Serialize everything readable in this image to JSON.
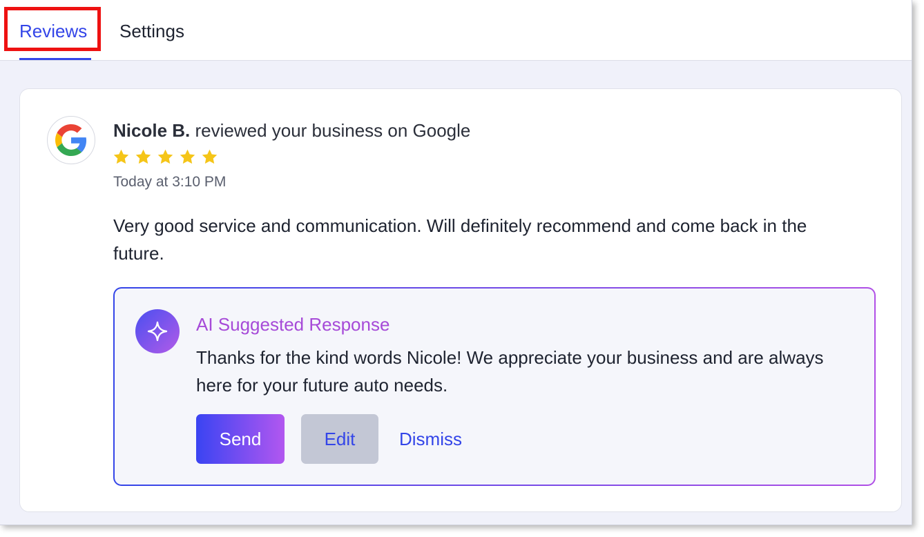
{
  "tabs": {
    "reviews": "Reviews",
    "settings": "Settings"
  },
  "review": {
    "platform_icon": "google-logo",
    "reviewer_name": "Nicole B.",
    "action_text": " reviewed your business on Google",
    "rating": 5,
    "rating_max": 5,
    "timestamp": "Today at 3:10 PM",
    "text": "Very good service and communication. Will definitely recommend and come back in the future."
  },
  "ai_response": {
    "icon": "sparkle-icon",
    "title": "AI Suggested Response",
    "text": "Thanks for the kind words Nicole! We appreciate your business and are always here for your future auto needs.",
    "buttons": {
      "send": "Send",
      "edit": "Edit",
      "dismiss": "Dismiss"
    }
  },
  "colors": {
    "accent": "#3345e8",
    "ai_purple": "#a64ad8",
    "star": "#f5c518",
    "highlight": "#ee1111"
  }
}
